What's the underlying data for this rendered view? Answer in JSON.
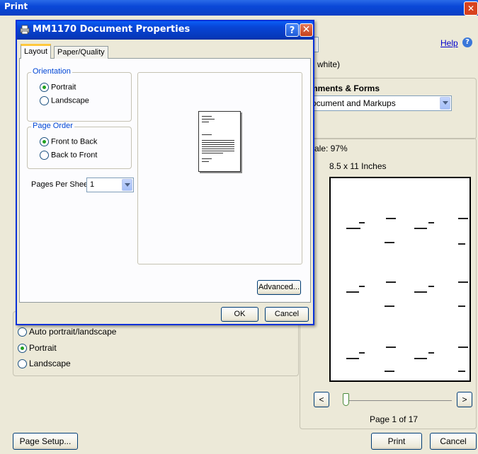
{
  "print": {
    "title": "Print",
    "help_label": "Help",
    "color_fragment": "d white)",
    "comments_header": "mments & Forms",
    "comments_value": "ocument and Markups",
    "scale": "cale: 97%",
    "paper_size": "8.5 x 11 Inches",
    "orientation_options": [
      "Auto portrait/landscape",
      "Portrait",
      "Landscape"
    ],
    "page_indicator": "Page 1 of 17",
    "page_setup_label": "Page Setup...",
    "print_label": "Print",
    "cancel_label": "Cancel",
    "prev_label": "<",
    "next_label": ">"
  },
  "props": {
    "title": "MM1170 Document Properties",
    "help_glyph": "?",
    "close_glyph": "✕",
    "tabs": [
      "Layout",
      "Paper/Quality"
    ],
    "orientation_legend": "Orientation",
    "orientation_options": [
      "Portrait",
      "Landscape"
    ],
    "page_order_legend": "Page Order",
    "page_order_options": [
      "Front to Back",
      "Back to Front"
    ],
    "pages_per_sheet_label": "Pages Per Sheet:",
    "pages_per_sheet_value": "1",
    "advanced_label": "Advanced...",
    "ok_label": "OK",
    "cancel_label": "Cancel"
  }
}
